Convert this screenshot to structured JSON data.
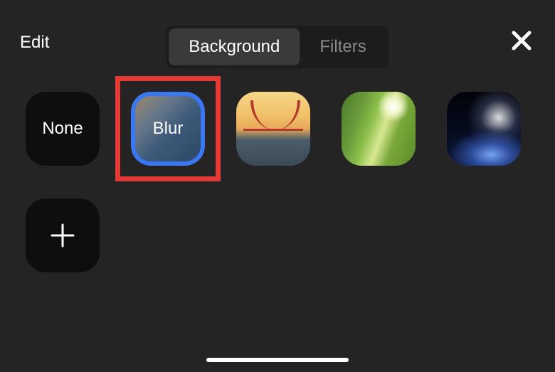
{
  "header": {
    "edit_label": "Edit"
  },
  "tabs": {
    "background_label": "Background",
    "filters_label": "Filters",
    "active": "background"
  },
  "options": {
    "none_label": "None",
    "blur_label": "Blur",
    "selected": "blur",
    "highlighted": "blur"
  }
}
